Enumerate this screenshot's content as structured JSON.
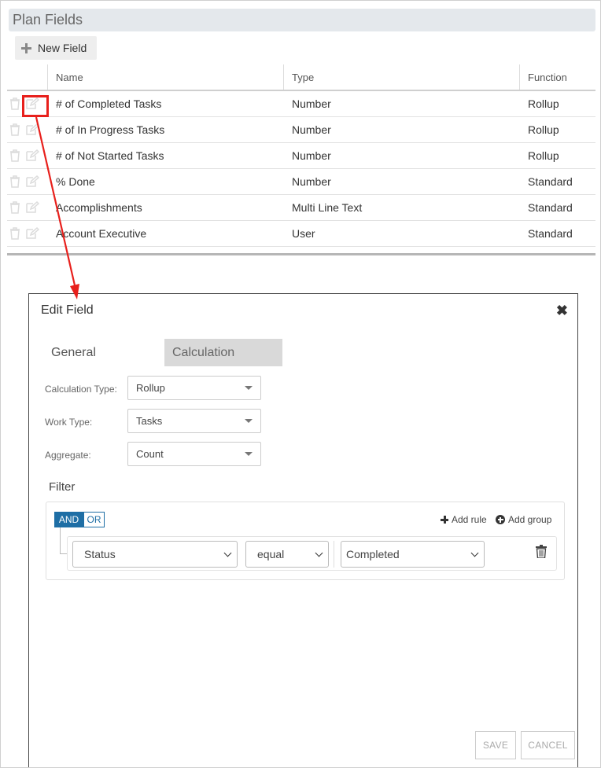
{
  "panel": {
    "title": "Plan Fields"
  },
  "toolbar": {
    "new_field_label": "New Field"
  },
  "table": {
    "columns": [
      "Name",
      "Type",
      "Function"
    ],
    "rows": [
      {
        "name": "# of Completed Tasks",
        "type": "Number",
        "function": "Rollup"
      },
      {
        "name": "# of In Progress Tasks",
        "type": "Number",
        "function": "Rollup"
      },
      {
        "name": "# of Not Started Tasks",
        "type": "Number",
        "function": "Rollup"
      },
      {
        "name": "% Done",
        "type": "Number",
        "function": "Standard"
      },
      {
        "name": "Accomplishments",
        "type": "Multi Line Text",
        "function": "Standard"
      },
      {
        "name": "Account Executive",
        "type": "User",
        "function": "Standard"
      }
    ]
  },
  "dialog": {
    "title": "Edit Field",
    "tabs": {
      "general": "General",
      "calculation": "Calculation"
    },
    "fields": {
      "calculation_type": {
        "label": "Calculation Type:",
        "value": "Rollup"
      },
      "work_type": {
        "label": "Work Type:",
        "value": "Tasks"
      },
      "aggregate": {
        "label": "Aggregate:",
        "value": "Count"
      }
    },
    "filter": {
      "heading": "Filter",
      "and_label": "AND",
      "or_label": "OR",
      "add_rule_label": "Add rule",
      "add_group_label": "Add group",
      "rule": {
        "field": "Status",
        "operator": "equal",
        "value": "Completed"
      }
    },
    "buttons": {
      "save": "SAVE",
      "cancel": "CANCEL"
    }
  },
  "colors": {
    "annotation_red": "#e8201c",
    "and_blue": "#1e6ea5",
    "tab_active_bg": "#d9d9d9",
    "header_bg": "#e4e8ec"
  },
  "icons": [
    "plus-icon",
    "trash-icon",
    "edit-icon",
    "close-icon",
    "chevron-down-icon",
    "plus-circle-icon"
  ]
}
